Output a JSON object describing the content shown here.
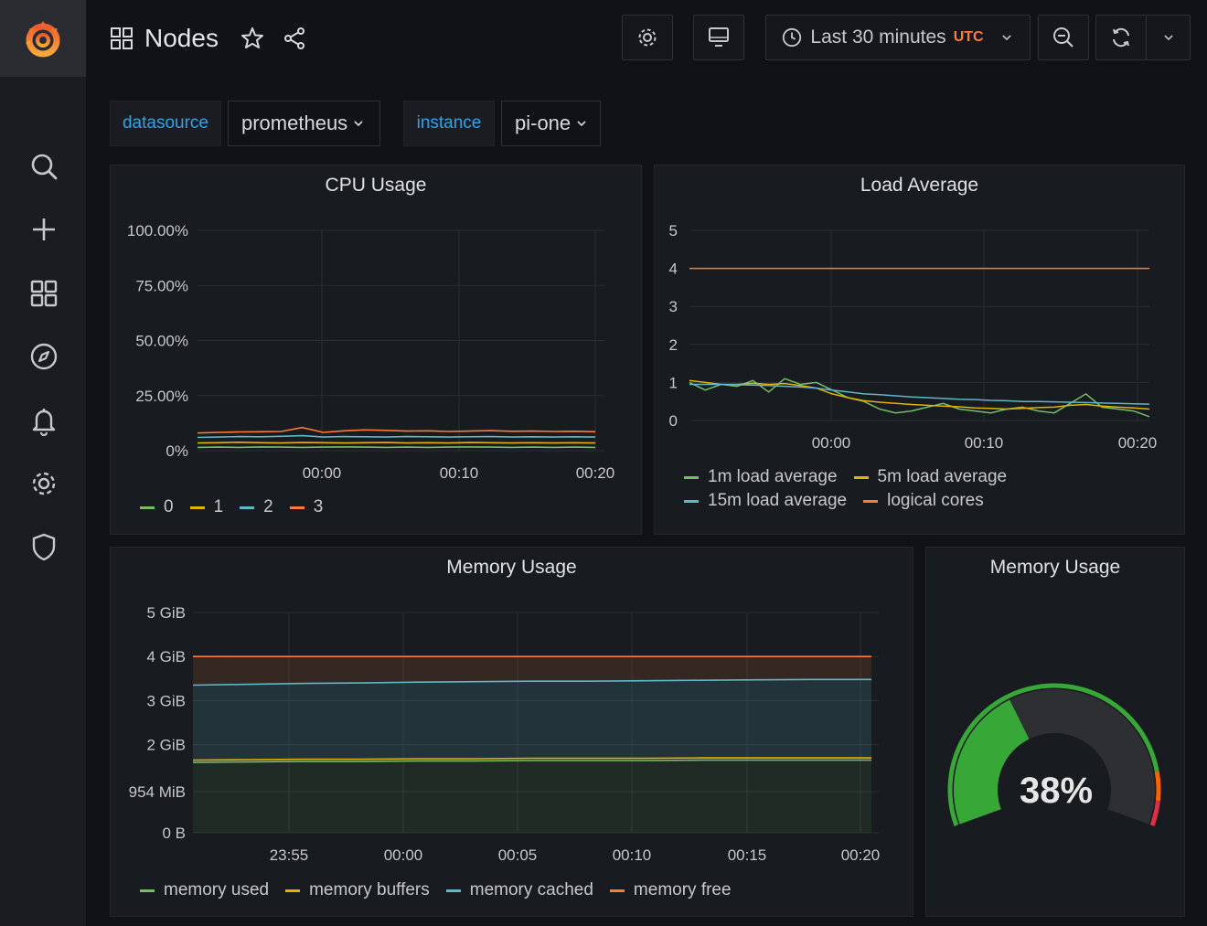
{
  "header": {
    "title": "Nodes",
    "time_range": "Last 30 minutes",
    "timezone": "UTC"
  },
  "variables": [
    {
      "label": "datasource",
      "value": "prometheus"
    },
    {
      "label": "instance",
      "value": "pi-one"
    }
  ],
  "sidebar": {
    "items": [
      "search-icon",
      "plus-icon",
      "dashboards-icon",
      "explore-compass-icon",
      "alerting-bell-icon",
      "configuration-gear-icon",
      "server-admin-shield-icon"
    ]
  },
  "colors": {
    "green": "#73bf69",
    "yellow": "#f2cc0c",
    "blue": "#8ab8ff",
    "orange": "#ff9830",
    "cyan": "#5fb7c9",
    "accent_blue": "#33a2e5",
    "gauge_green": "#37a738"
  },
  "panels": {
    "cpu": {
      "title": "CPU Usage",
      "y_ticks": [
        "100.00%",
        "75.00%",
        "50.00%",
        "25.00%",
        "0%"
      ],
      "x_ticks": [
        "00:00",
        "00:10",
        "00:20"
      ]
    },
    "load": {
      "title": "Load Average",
      "y_ticks": [
        "5",
        "4",
        "3",
        "2",
        "1",
        "0"
      ],
      "x_ticks": [
        "00:00",
        "00:10",
        "00:20"
      ]
    },
    "memory": {
      "title": "Memory Usage",
      "y_ticks": [
        "5 GiB",
        "4 GiB",
        "3 GiB",
        "2 GiB",
        "954 MiB",
        "0 B"
      ],
      "x_ticks": [
        "23:55",
        "00:00",
        "00:05",
        "00:10",
        "00:15",
        "00:20"
      ]
    },
    "gauge": {
      "title": "Memory Usage",
      "value_text": "38%",
      "value": 38
    }
  },
  "chart_data": [
    {
      "type": "line",
      "title": "CPU Usage",
      "ylim": [
        0,
        100
      ],
      "y_unit": "percent",
      "x_labels": [
        "00:00",
        "00:10",
        "00:20"
      ],
      "series": [
        {
          "name": "0",
          "color": "#73bf69",
          "values": [
            1.5,
            1.6,
            1.5,
            1.7,
            1.6,
            1.5,
            1.6,
            1.7,
            1.6,
            1.5,
            1.6,
            1.5,
            1.6,
            1.7,
            1.6,
            1.5,
            1.6,
            1.5,
            1.6,
            1.5
          ]
        },
        {
          "name": "1",
          "color": "#e0b400",
          "values": [
            3.5,
            3.6,
            3.8,
            3.6,
            3.5,
            3.7,
            3.6,
            3.5,
            3.6,
            3.7,
            3.5,
            3.6,
            3.5,
            3.7,
            3.6,
            3.5,
            3.6,
            3.5,
            3.6,
            3.5
          ]
        },
        {
          "name": "2",
          "color": "#5fb7c9",
          "values": [
            6.0,
            6.2,
            6.4,
            6.3,
            6.5,
            6.8,
            6.2,
            6.4,
            6.3,
            6.2,
            6.4,
            6.3,
            6.2,
            6.3,
            6.4,
            6.2,
            6.3,
            6.2,
            6.3,
            6.2
          ]
        },
        {
          "name": "3",
          "color": "#ff7b36",
          "values": [
            8.0,
            8.3,
            8.5,
            8.6,
            8.7,
            10.5,
            8.3,
            9.0,
            9.4,
            9.2,
            8.9,
            9.0,
            8.7,
            8.9,
            9.1,
            8.8,
            8.9,
            8.7,
            8.8,
            8.6
          ]
        }
      ]
    },
    {
      "type": "line",
      "title": "Load Average",
      "ylim": [
        0,
        5
      ],
      "x_labels": [
        "00:00",
        "00:10",
        "00:20"
      ],
      "series": [
        {
          "name": "1m load average",
          "color": "#73bf69",
          "values": [
            1.0,
            0.8,
            0.95,
            0.9,
            1.05,
            0.75,
            1.1,
            0.95,
            1.0,
            0.8,
            0.6,
            0.5,
            0.3,
            0.2,
            0.25,
            0.35,
            0.45,
            0.3,
            0.25,
            0.2,
            0.3,
            0.35,
            0.25,
            0.2,
            0.45,
            0.7,
            0.35,
            0.3,
            0.25,
            0.1
          ]
        },
        {
          "name": "5m load average",
          "color": "#e0b400",
          "values": [
            1.05,
            1.0,
            0.95,
            0.95,
            0.98,
            0.95,
            0.97,
            0.92,
            0.85,
            0.7,
            0.6,
            0.52,
            0.48,
            0.45,
            0.42,
            0.4,
            0.38,
            0.36,
            0.33,
            0.32,
            0.3,
            0.32,
            0.34,
            0.35,
            0.4,
            0.42,
            0.38,
            0.35,
            0.33,
            0.3
          ]
        },
        {
          "name": "15m load average",
          "color": "#5fb7c9",
          "values": [
            0.95,
            0.95,
            0.95,
            0.94,
            0.93,
            0.92,
            0.9,
            0.88,
            0.85,
            0.8,
            0.75,
            0.7,
            0.68,
            0.65,
            0.62,
            0.6,
            0.58,
            0.56,
            0.55,
            0.53,
            0.52,
            0.5,
            0.5,
            0.49,
            0.48,
            0.47,
            0.46,
            0.45,
            0.44,
            0.43
          ]
        },
        {
          "name": "logical cores",
          "color": "#ff7b36",
          "values": [
            4,
            4,
            4,
            4,
            4,
            4,
            4,
            4,
            4,
            4,
            4,
            4,
            4,
            4,
            4,
            4,
            4,
            4,
            4,
            4,
            4,
            4,
            4,
            4,
            4,
            4,
            4,
            4,
            4,
            4
          ]
        }
      ]
    },
    {
      "type": "area",
      "title": "Memory Usage",
      "ylim": [
        0,
        5
      ],
      "y_unit": "GiB",
      "x_labels": [
        "23:55",
        "00:00",
        "00:05",
        "00:10",
        "00:15",
        "00:20"
      ],
      "series": [
        {
          "name": "memory used",
          "color": "#73bf69",
          "values": [
            1.6,
            1.61,
            1.62,
            1.62,
            1.63,
            1.63,
            1.64,
            1.64,
            1.64,
            1.65,
            1.65,
            1.65,
            1.65
          ]
        },
        {
          "name": "memory buffers",
          "color": "#e0b400",
          "values": [
            1.65,
            1.66,
            1.67,
            1.67,
            1.68,
            1.68,
            1.69,
            1.69,
            1.69,
            1.7,
            1.7,
            1.7,
            1.7
          ]
        },
        {
          "name": "memory cached",
          "color": "#5fb7c9",
          "values": [
            3.35,
            3.37,
            3.39,
            3.4,
            3.42,
            3.43,
            3.44,
            3.44,
            3.45,
            3.46,
            3.47,
            3.48,
            3.48
          ]
        },
        {
          "name": "memory free",
          "color": "#ff7b36",
          "values": [
            4.0,
            4.0,
            4.0,
            4.0,
            4.0,
            4.0,
            4.0,
            4.0,
            4.0,
            4.0,
            4.0,
            4.0,
            4.0
          ]
        }
      ]
    }
  ]
}
